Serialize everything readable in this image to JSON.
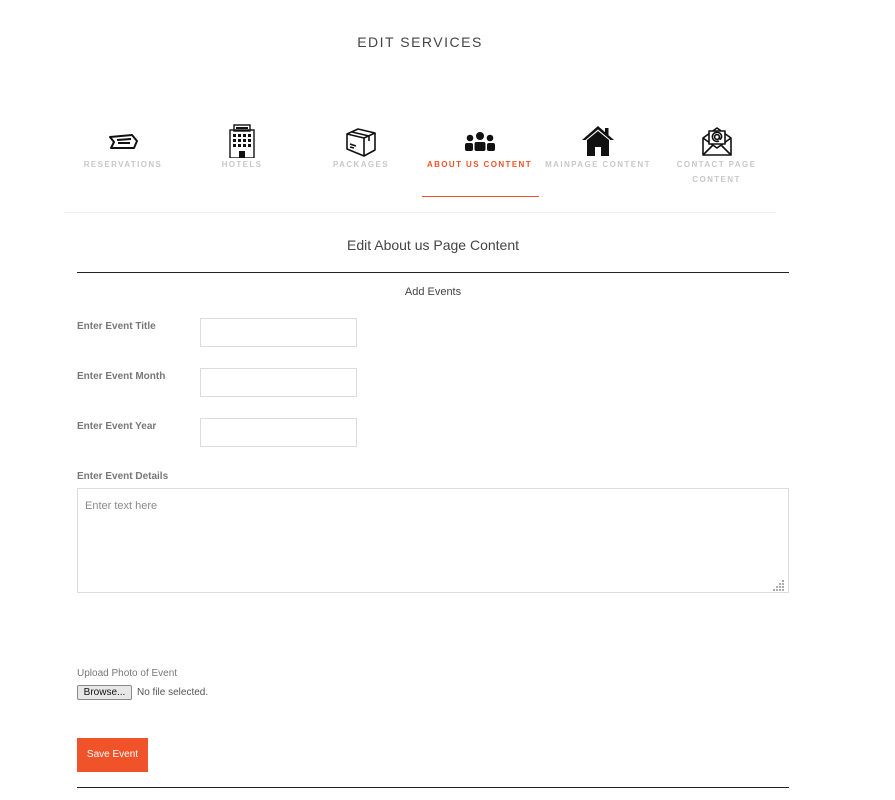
{
  "header": {
    "title": "EDIT SERVICES"
  },
  "tabs": [
    {
      "label": "RESERVATIONS",
      "icon": "ticket-icon",
      "active": false
    },
    {
      "label": "HOTELS",
      "icon": "hotel-icon",
      "active": false
    },
    {
      "label": "PACKAGES",
      "icon": "package-icon",
      "active": false
    },
    {
      "label": "ABOUT US CONTENT",
      "icon": "group-icon",
      "active": true
    },
    {
      "label": "MAINPAGE CONTENT",
      "icon": "home-icon",
      "active": false
    },
    {
      "label": "CONTACT PAGE CONTENT",
      "icon": "email-icon",
      "active": false
    }
  ],
  "section": {
    "title": "Edit About us Page Content",
    "subheading": "Add Events"
  },
  "form": {
    "title_label": "Enter Event Title",
    "title_value": "",
    "month_label": "Enter Event Month",
    "month_value": "",
    "year_label": "Enter Event Year",
    "year_value": "",
    "details_label": "Enter Event Details",
    "details_placeholder": "Enter text here",
    "upload_label": "Upload Photo of Event",
    "browse_label": "Browse...",
    "file_status": "No file selected.",
    "save_label": "Save Event"
  },
  "colors": {
    "accent": "#f0532a",
    "inactive_tab": "#c8c8c8",
    "rule": "#222222"
  }
}
